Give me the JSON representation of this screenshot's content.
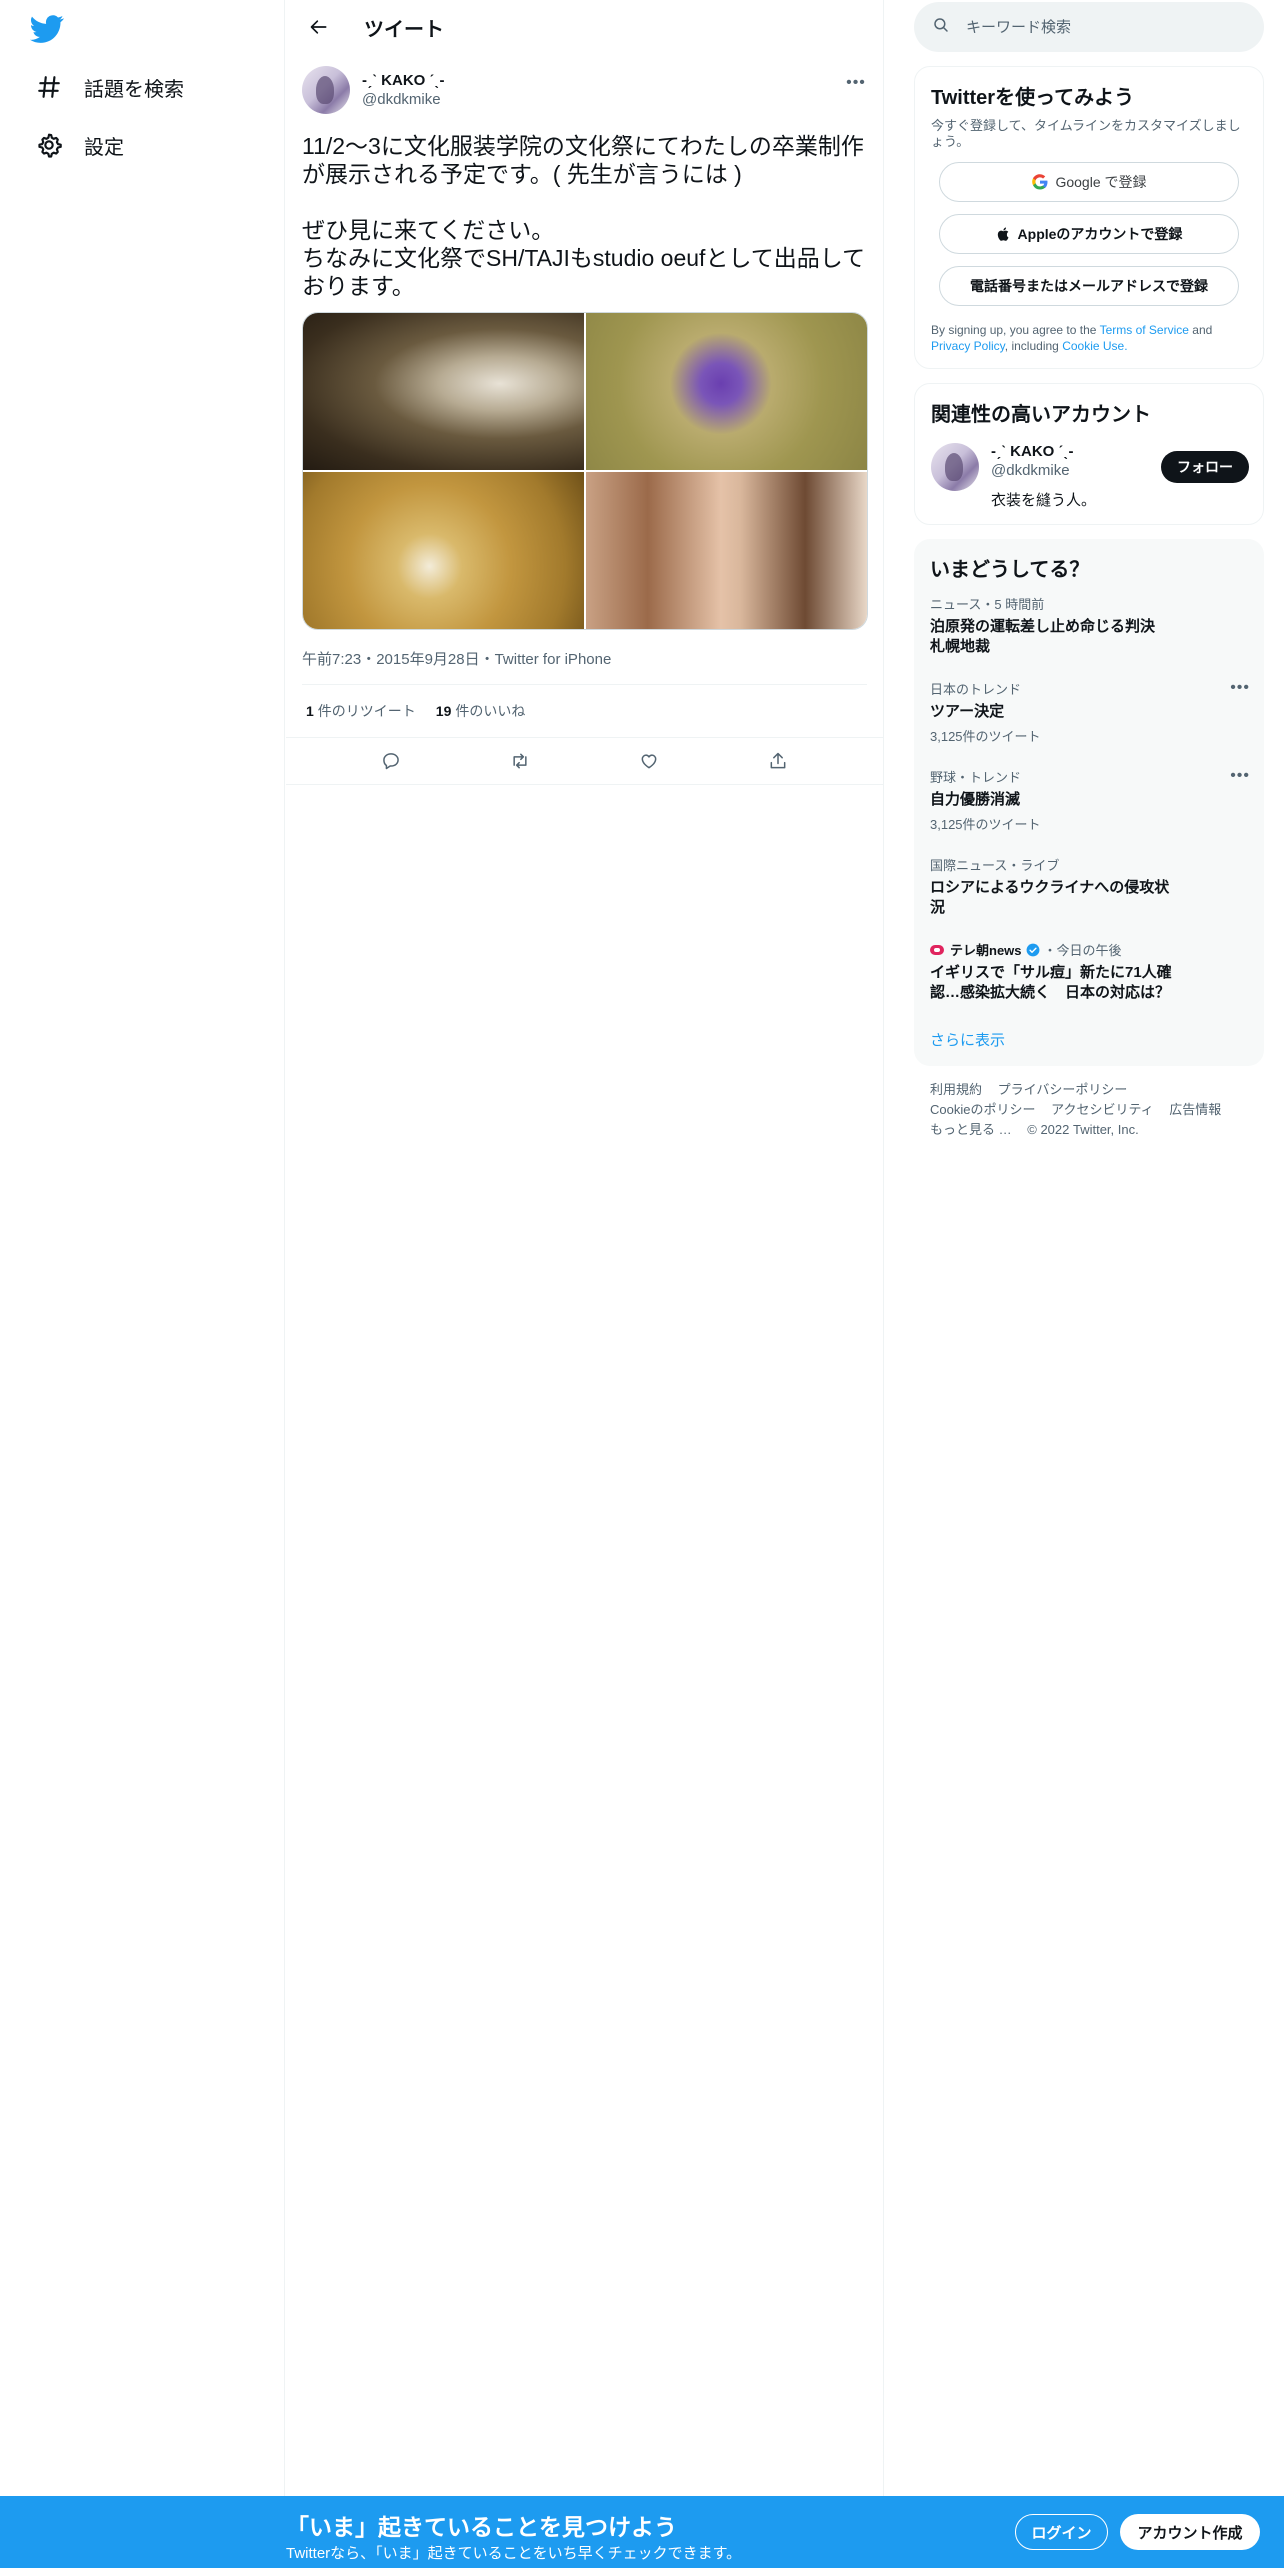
{
  "nav": {
    "items": [
      {
        "label": "話題を検索",
        "icon": "hashtag-icon"
      },
      {
        "label": "設定",
        "icon": "gear-icon"
      }
    ]
  },
  "header": {
    "title": "ツイート"
  },
  "tweet": {
    "author_name": "-ˏˋ KAKO ˊˎ-",
    "author_handle": "@dkdkmike",
    "text": "11/2〜3に文化服装学院の文化祭にてわたしの卒業制作が展示される予定です。( 先生が言うには )\n\nぜひ見に来てください。\nちなみに文化祭でSH/TAJIもstudio oeufとして出品しております。",
    "meta": "午前7:23・2015年9月28日・Twitter for iPhone",
    "retweets_count": "1",
    "retweets_label": "件のリツイート",
    "likes_count": "19",
    "likes_label": "件のいいね"
  },
  "search": {
    "placeholder": "キーワード検索"
  },
  "signup_card": {
    "title": "Twitterを使ってみよう",
    "subtitle": "今すぐ登録して、タイムラインをカスタマイズしましょう。",
    "google": "Google で登録",
    "apple": "Appleのアカウントで登録",
    "phone": "電話番号またはメールアドレスで登録",
    "terms_prefix": "By signing up, you agree to the",
    "terms_link": "Terms of Service",
    "terms_and": "and",
    "privacy_link": "Privacy Policy",
    "including": ", including",
    "cookie_link": "Cookie Use."
  },
  "related": {
    "title": "関連性の高いアカウント",
    "name": "-ˏˋ KAKO ˊˎ-",
    "handle": "@dkdkmike",
    "bio": "衣装を縫う人。",
    "follow": "フォロー"
  },
  "trends": {
    "title": "いまどうしてる？",
    "items": [
      {
        "category": "ニュース・5 時間前",
        "title": "泊原発の運転差し止め命じる判決　札幌地裁",
        "count": ""
      },
      {
        "category": "日本のトレンド",
        "title": "ツアー決定",
        "count": "3,125件のツイート"
      },
      {
        "category": "野球・トレンド",
        "title": "自力優勝消滅",
        "count": "3,125件のツイート"
      },
      {
        "category": "国際ニュース・ライブ",
        "title": "ロシアによるウクライナへの侵攻状況",
        "count": ""
      },
      {
        "source": "テレ朝news",
        "time": "・今日の午後",
        "title": "イギリスで「サル痘」新たに71人確認…感染拡大続く　日本の対応は？"
      }
    ],
    "show_more": "さらに表示"
  },
  "footer": {
    "line1": [
      "利用規約",
      "プライバシーポリシー"
    ],
    "line2": [
      "Cookieのポリシー",
      "アクセシビリティ",
      "広告情報"
    ],
    "more": "もっと見る …",
    "copyright": "© 2022 Twitter, Inc."
  },
  "bottom_bar": {
    "title": "「いま」起きていることを見つけよう",
    "subtitle": "Twitterなら、「いま」起きていることをいち早くチェックできます。",
    "login": "ログイン",
    "signup": "アカウント作成"
  },
  "colors": {
    "accent": "#1d9bf0",
    "text": "#0f1419",
    "muted": "#536471"
  }
}
